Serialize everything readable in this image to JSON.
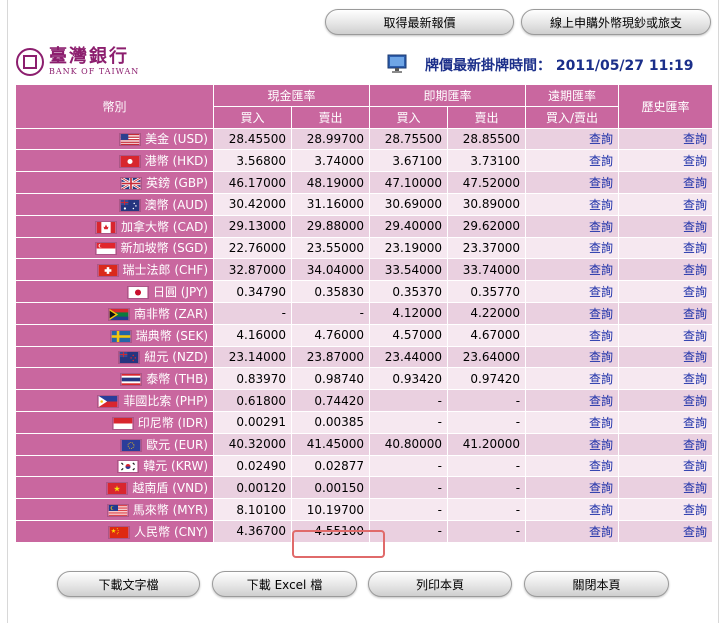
{
  "top_buttons": {
    "latest_quote": "取得最新報價",
    "online_apply": "線上申購外幣現鈔或旅支"
  },
  "logo": {
    "name_zh": "臺灣銀行",
    "name_en": "BANK OF TAIWAN"
  },
  "update": {
    "label": "牌價最新掛牌時間：",
    "datetime": "2011/05/27 11:19"
  },
  "table": {
    "headers": {
      "currency": "幣別",
      "cash_rate": "現金匯率",
      "spot_rate": "即期匯率",
      "forward_rate": "遠期匯率",
      "history_rate": "歷史匯率",
      "buy": "買入",
      "sell": "賣出",
      "buy_sell": "買入/賣出"
    },
    "rows": [
      {
        "name": "美金 (USD)",
        "flag": "us",
        "cash_buy": "28.45500",
        "cash_sell": "28.99700",
        "spot_buy": "28.75500",
        "spot_sell": "28.85500",
        "forward": "查詢",
        "history": "查詢"
      },
      {
        "name": "港幣 (HKD)",
        "flag": "hk",
        "cash_buy": "3.56800",
        "cash_sell": "3.74000",
        "spot_buy": "3.67100",
        "spot_sell": "3.73100",
        "forward": "查詢",
        "history": "查詢"
      },
      {
        "name": "英鎊 (GBP)",
        "flag": "gb",
        "cash_buy": "46.17000",
        "cash_sell": "48.19000",
        "spot_buy": "47.10000",
        "spot_sell": "47.52000",
        "forward": "查詢",
        "history": "查詢"
      },
      {
        "name": "澳幣 (AUD)",
        "flag": "au",
        "cash_buy": "30.42000",
        "cash_sell": "31.16000",
        "spot_buy": "30.69000",
        "spot_sell": "30.89000",
        "forward": "查詢",
        "history": "查詢"
      },
      {
        "name": "加拿大幣 (CAD)",
        "flag": "ca",
        "cash_buy": "29.13000",
        "cash_sell": "29.88000",
        "spot_buy": "29.40000",
        "spot_sell": "29.62000",
        "forward": "查詢",
        "history": "查詢"
      },
      {
        "name": "新加坡幣 (SGD)",
        "flag": "sg",
        "cash_buy": "22.76000",
        "cash_sell": "23.55000",
        "spot_buy": "23.19000",
        "spot_sell": "23.37000",
        "forward": "查詢",
        "history": "查詢"
      },
      {
        "name": "瑞士法郎 (CHF)",
        "flag": "ch",
        "cash_buy": "32.87000",
        "cash_sell": "34.04000",
        "spot_buy": "33.54000",
        "spot_sell": "33.74000",
        "forward": "查詢",
        "history": "查詢"
      },
      {
        "name": "日圓 (JPY)",
        "flag": "jp",
        "cash_buy": "0.34790",
        "cash_sell": "0.35830",
        "spot_buy": "0.35370",
        "spot_sell": "0.35770",
        "forward": "查詢",
        "history": "查詢"
      },
      {
        "name": "南非幣 (ZAR)",
        "flag": "za",
        "cash_buy": "-",
        "cash_sell": "-",
        "spot_buy": "4.12000",
        "spot_sell": "4.22000",
        "forward": "查詢",
        "history": "查詢"
      },
      {
        "name": "瑞典幣 (SEK)",
        "flag": "se",
        "cash_buy": "4.16000",
        "cash_sell": "4.76000",
        "spot_buy": "4.57000",
        "spot_sell": "4.67000",
        "forward": "查詢",
        "history": "查詢"
      },
      {
        "name": "紐元 (NZD)",
        "flag": "nz",
        "cash_buy": "23.14000",
        "cash_sell": "23.87000",
        "spot_buy": "23.44000",
        "spot_sell": "23.64000",
        "forward": "查詢",
        "history": "查詢"
      },
      {
        "name": "泰幣 (THB)",
        "flag": "th",
        "cash_buy": "0.83970",
        "cash_sell": "0.98740",
        "spot_buy": "0.93420",
        "spot_sell": "0.97420",
        "forward": "查詢",
        "history": "查詢"
      },
      {
        "name": "菲國比索 (PHP)",
        "flag": "ph",
        "cash_buy": "0.61800",
        "cash_sell": "0.74420",
        "spot_buy": "-",
        "spot_sell": "-",
        "forward": "查詢",
        "history": "查詢"
      },
      {
        "name": "印尼幣 (IDR)",
        "flag": "id",
        "cash_buy": "0.00291",
        "cash_sell": "0.00385",
        "spot_buy": "-",
        "spot_sell": "-",
        "forward": "查詢",
        "history": "查詢"
      },
      {
        "name": "歐元 (EUR)",
        "flag": "eu",
        "cash_buy": "40.32000",
        "cash_sell": "41.45000",
        "spot_buy": "40.80000",
        "spot_sell": "41.20000",
        "forward": "查詢",
        "history": "查詢"
      },
      {
        "name": "韓元 (KRW)",
        "flag": "kr",
        "cash_buy": "0.02490",
        "cash_sell": "0.02877",
        "spot_buy": "-",
        "spot_sell": "-",
        "forward": "查詢",
        "history": "查詢"
      },
      {
        "name": "越南盾 (VND)",
        "flag": "vn",
        "cash_buy": "0.00120",
        "cash_sell": "0.00150",
        "spot_buy": "-",
        "spot_sell": "-",
        "forward": "查詢",
        "history": "查詢"
      },
      {
        "name": "馬來幣 (MYR)",
        "flag": "my",
        "cash_buy": "8.10100",
        "cash_sell": "10.19700",
        "spot_buy": "-",
        "spot_sell": "-",
        "forward": "查詢",
        "history": "查詢"
      },
      {
        "name": "人民幣 (CNY)",
        "flag": "cn",
        "cash_buy": "4.36700",
        "cash_sell": "4.55100",
        "spot_buy": "-",
        "spot_sell": "-",
        "forward": "查詢",
        "history": "查詢"
      }
    ]
  },
  "bottom_buttons": {
    "download_text": "下載文字檔",
    "download_excel": "下載 Excel 檔",
    "print": "列印本頁",
    "close": "關閉本頁"
  },
  "colors": {
    "header_bg": "#c9679f",
    "row_odd": "#ead0e0",
    "row_even": "#f6e8f0",
    "link": "#1c2fa8",
    "title_blue": "#1b2f8a",
    "brand": "#8c1e6e",
    "highlight": "#e06a6a"
  }
}
